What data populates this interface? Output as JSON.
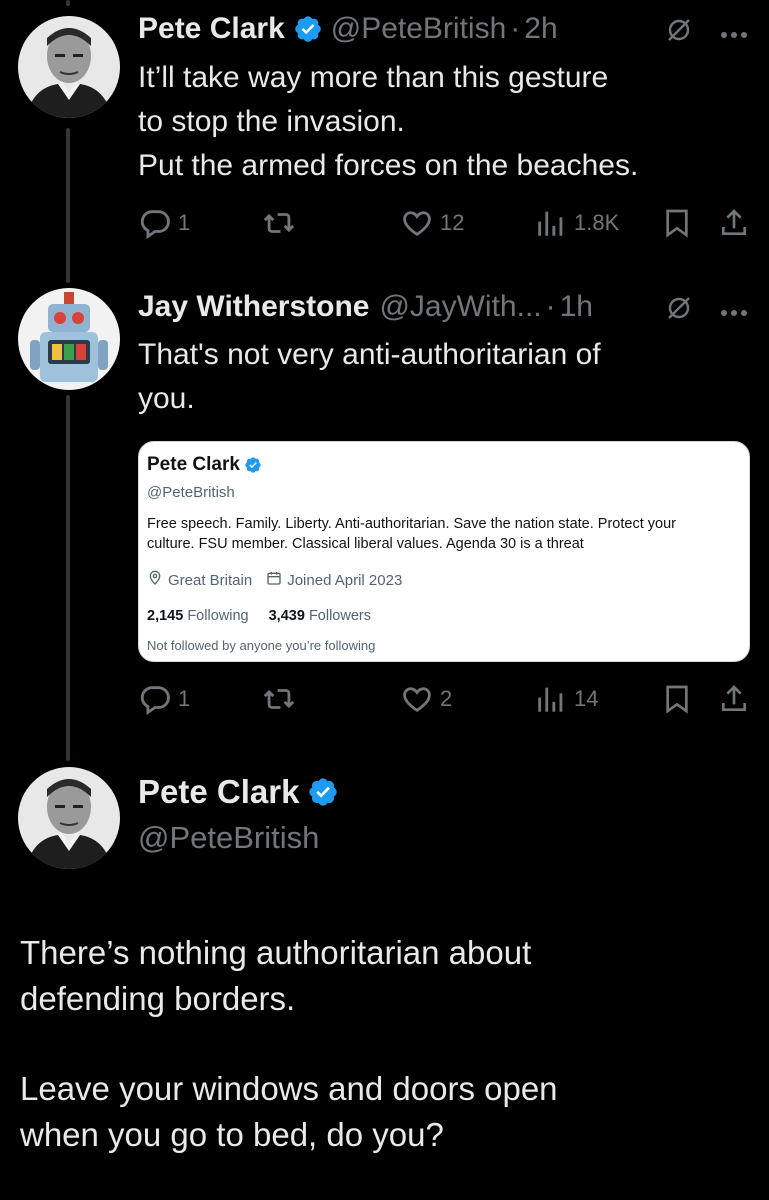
{
  "tweets": [
    {
      "author": {
        "name": "Pete Clark",
        "handle": "@PeteBritish",
        "time": "2h"
      },
      "text_lines": [
        "It’ll take way more than this gesture",
        "to stop the invasion.",
        "Put the armed forces on the beaches."
      ],
      "stats": {
        "replies": "1",
        "likes": "12",
        "views": "1.8K"
      }
    },
    {
      "author": {
        "name": "Jay Witherstone",
        "handle": "@JayWith...",
        "time": "1h"
      },
      "text_lines": [
        "That's not very anti-authoritarian of",
        "you."
      ],
      "stats": {
        "replies": "1",
        "likes": "2",
        "views": "14"
      },
      "embedded_profile": {
        "name": "Pete Clark",
        "handle": "@PeteBritish",
        "bio_lines": [
          "Free speech. Family. Liberty. Anti-authoritarian. Save the nation state. Protect your",
          "culture. FSU member. Classical liberal values. Agenda 30 is a threat"
        ],
        "location": "Great Britain",
        "joined": "Joined April 2023",
        "following_count": "2,145",
        "following_label": "Following",
        "followers_count": "3,439",
        "followers_label": "Followers",
        "note": "Not followed by anyone you’re following"
      }
    }
  ],
  "main_tweet": {
    "author": {
      "name": "Pete Clark",
      "handle": "@PeteBritish"
    },
    "paragraph1": [
      "There’s nothing authoritarian about",
      "defending borders."
    ],
    "paragraph2": [
      "Leave your windows and doors open",
      "when you go to bed, do you?"
    ]
  },
  "separator": "·",
  "colors": {
    "background": "#000000",
    "text": "#e7e9ea",
    "muted": "#71767b",
    "verified": "#1d9bf0"
  },
  "icons": [
    "verified-badge-icon",
    "grok-icon",
    "more-icon",
    "reply-icon",
    "retweet-icon",
    "like-icon",
    "views-icon",
    "bookmark-icon",
    "share-icon",
    "location-icon",
    "calendar-icon"
  ]
}
